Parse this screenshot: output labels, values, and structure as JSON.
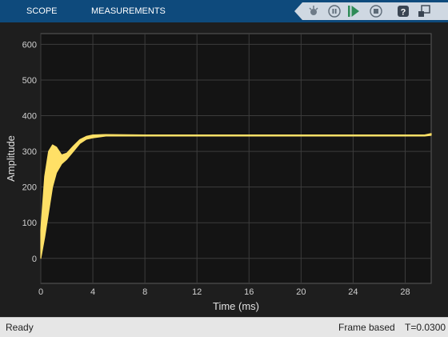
{
  "toolbar": {
    "tabs": [
      "SCOPE",
      "MEASUREMENTS"
    ],
    "icons": [
      "signal-selector-icon",
      "pause-icon",
      "step-forward-icon",
      "stop-icon",
      "help-icon",
      "undock-icon"
    ]
  },
  "status": {
    "ready": "Ready",
    "mode": "Frame based",
    "time": "T=0.0300"
  },
  "colors": {
    "toolbar": "#0e4a7c",
    "plot_bg": "#141414",
    "signal": "#ffe066"
  },
  "chart_data": {
    "type": "line",
    "title": "",
    "xlabel": "Time (ms)",
    "ylabel": "Amplitude",
    "xlim": [
      0,
      30
    ],
    "ylim": [
      -70,
      630
    ],
    "xticks": [
      0,
      4,
      8,
      12,
      16,
      20,
      24,
      28
    ],
    "yticks": [
      0,
      100,
      200,
      300,
      400,
      500,
      600
    ],
    "grid": true,
    "series": [
      {
        "color": "#ffe066",
        "upper": [
          [
            0,
            80
          ],
          [
            0.3,
            230
          ],
          [
            0.6,
            300
          ],
          [
            0.9,
            318
          ],
          [
            1.2,
            312
          ],
          [
            1.6,
            290
          ],
          [
            2,
            295
          ],
          [
            2.5,
            315
          ],
          [
            3,
            333
          ],
          [
            3.5,
            342
          ],
          [
            4,
            346
          ],
          [
            5,
            347
          ],
          [
            8,
            346
          ],
          [
            12,
            346
          ],
          [
            16,
            346
          ],
          [
            20,
            346
          ],
          [
            24,
            346
          ],
          [
            28,
            346
          ],
          [
            29.5,
            346
          ],
          [
            30,
            350
          ]
        ],
        "lower": [
          [
            0,
            0
          ],
          [
            0.3,
            60
          ],
          [
            0.6,
            130
          ],
          [
            0.9,
            200
          ],
          [
            1.2,
            240
          ],
          [
            1.6,
            265
          ],
          [
            2,
            278
          ],
          [
            2.5,
            300
          ],
          [
            3,
            322
          ],
          [
            3.5,
            334
          ],
          [
            4,
            338
          ],
          [
            5,
            343
          ],
          [
            8,
            343
          ],
          [
            12,
            343
          ],
          [
            16,
            343
          ],
          [
            20,
            343
          ],
          [
            24,
            343
          ],
          [
            28,
            343
          ],
          [
            29.5,
            343
          ],
          [
            30,
            345
          ]
        ]
      }
    ]
  }
}
